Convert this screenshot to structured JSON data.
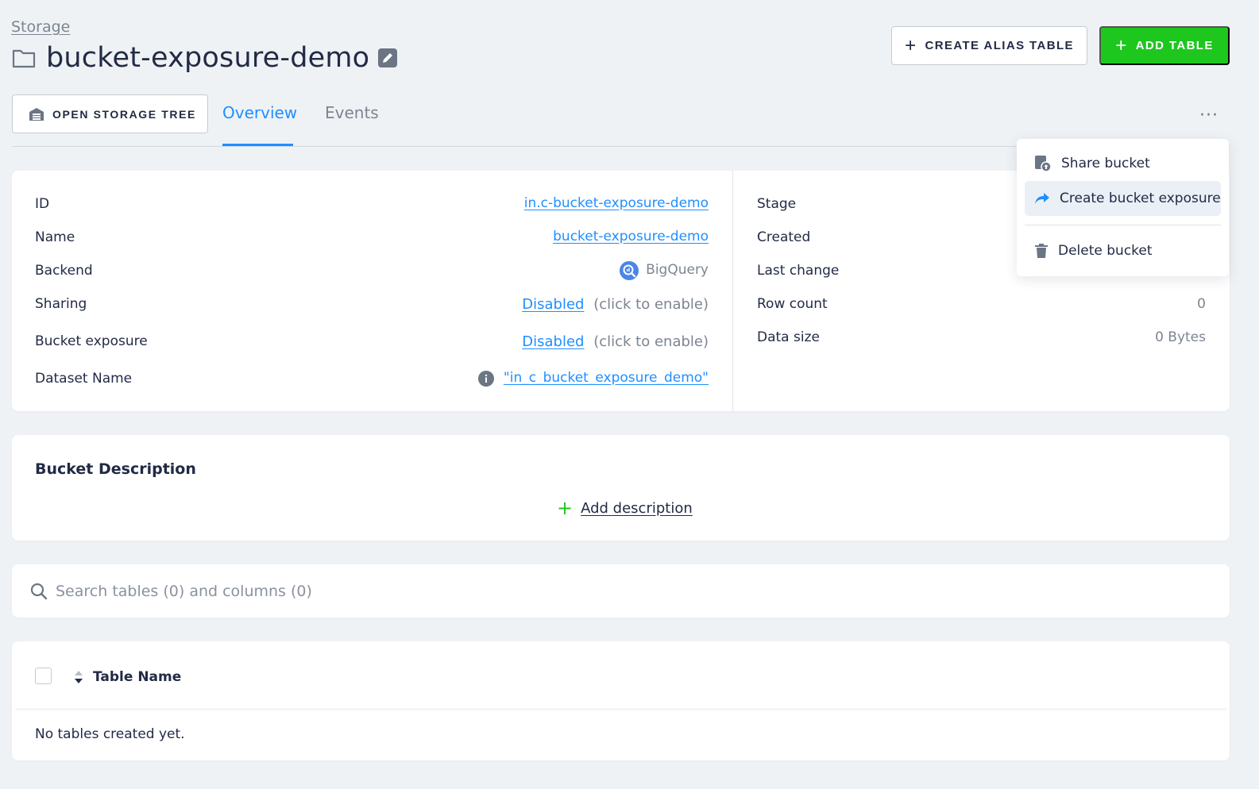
{
  "breadcrumb": {
    "label": "Storage"
  },
  "header": {
    "title": "bucket-exposure-demo",
    "create_alias_label": "CREATE ALIAS TABLE",
    "add_table_label": "ADD TABLE",
    "icons": {
      "folder": "folder-icon",
      "edit": "pencil-icon"
    }
  },
  "toolbar": {
    "open_tree_label": "OPEN STORAGE TREE",
    "more_label": "···"
  },
  "tabs": [
    {
      "label": "Overview",
      "active": true
    },
    {
      "label": "Events",
      "active": false
    }
  ],
  "info_left": {
    "id_label": "ID",
    "id_value": "in.c-bucket-exposure-demo",
    "name_label": "Name",
    "name_value": "bucket-exposure-demo",
    "backend_label": "Backend",
    "backend_value": "BigQuery",
    "sharing_label": "Sharing",
    "sharing_status": "Disabled",
    "sharing_hint": "(click to enable)",
    "exposure_label": "Bucket exposure",
    "exposure_status": "Disabled",
    "exposure_hint": "(click to enable)",
    "dataset_label": "Dataset Name",
    "dataset_value": "\"in_c_bucket_exposure_demo\""
  },
  "info_right": {
    "stage_label": "Stage",
    "created_label": "Created",
    "last_change_label": "Last change",
    "row_count_label": "Row count",
    "row_count_value": "0",
    "data_size_label": "Data size",
    "data_size_value": "0 Bytes"
  },
  "description": {
    "title": "Bucket Description",
    "add_label": "Add description"
  },
  "search": {
    "placeholder": "Search tables (0) and columns (0)"
  },
  "table": {
    "column_name": "Table Name",
    "empty_text": "No tables created yet."
  },
  "menu": {
    "share_label": "Share bucket",
    "expose_label": "Create bucket exposure",
    "delete_label": "Delete bucket"
  },
  "colors": {
    "accent": "#1f8fff",
    "primary_button": "#1ec71e",
    "background": "#eff2f5"
  }
}
